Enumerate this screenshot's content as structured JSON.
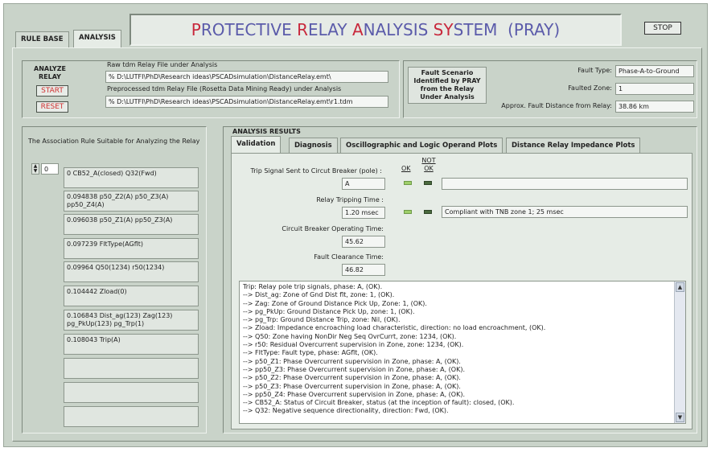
{
  "tabs": [
    "RULE BASE",
    "ANALYSIS"
  ],
  "title": {
    "parts": [
      {
        "t": "P",
        "red": true
      },
      {
        "t": "ROTECTIVE ",
        "red": false
      },
      {
        "t": "R",
        "red": true
      },
      {
        "t": "ELAY ",
        "red": false
      },
      {
        "t": "A",
        "red": true
      },
      {
        "t": "NALYSIS ",
        "red": false
      },
      {
        "t": "SY",
        "red": true
      },
      {
        "t": "STEM  (PRAY)",
        "red": false
      }
    ]
  },
  "stop_label": "STOP",
  "analyze": {
    "label": "ANALYZE RELAY",
    "start": "START",
    "reset": "RESET"
  },
  "files": {
    "raw_label": "Raw tdm Relay File under Analysis",
    "raw_path": "% D:\\LUTFI\\PhD\\Research ideas\\PSCADsimulation\\DistanceRelay.emt\\",
    "pre_label": "Preprocessed tdm Relay File  (Rosetta Data Mining Ready) under Analysis",
    "pre_path": "% D:\\LUTFI\\PhD\\Research ideas\\PSCADsimulation\\DistanceRelay.emt\\r1.tdm"
  },
  "fault": {
    "scenario_label": "Fault Scenario Identified by PRAY from the Relay Under Analysis",
    "type_label": "Fault Type:",
    "type_value": "Phase-A-to-Ground",
    "zone_label": "Faulted Zone:",
    "zone_value": "1",
    "dist_label": "Approx. Fault Distance from Relay:",
    "dist_value": "38.86 km"
  },
  "rules": {
    "heading": "The Association Rule Suitable for Analyzing the Relay",
    "index": "0",
    "items": [
      "0 CB52_A(closed) Q32(Fwd)",
      "0.094838 p50_Z2(A) p50_Z3(A) pp50_Z4(A)",
      "0.096038 p50_Z1(A) pp50_Z3(A)",
      "0.097239 FltType(AGflt)",
      "0.09964 Q50(1234) r50(1234)",
      "0.104442 Zload(0)",
      "0.106843 Dist_ag(123) Zag(123) pg_PkUp(123) pg_Trp(1)",
      "0.108043 Trip(A)",
      "",
      "",
      ""
    ]
  },
  "results": {
    "heading": "ANALYSIS RESULTS",
    "tabs": [
      "Validation",
      "Diagnosis",
      "Oscillographic and Logic Operand Plots",
      "Distance Relay Impedance Plots"
    ],
    "ok_label": "OK",
    "notok_label": "NOT OK",
    "trip_label": "Trip Signal Sent to Circut Breaker (pole) :",
    "trip_value": "A",
    "rtime_label": "Relay Tripping Time :",
    "rtime_value": "1.20 msec",
    "rtime_note": "Compliant with TNB zone 1; 25 msec",
    "cb_label": "Circuit Breaker Operating Time:",
    "cb_value": "45.62",
    "clear_label": "Fault Clearance Time:",
    "clear_value": "46.82",
    "log": [
      "Trip: Relay pole trip signals, phase: A, (OK).",
      "--> Dist_ag: Zone of Gnd Dist flt, zone: 1, (OK).",
      "--> Zag: Zone of Ground Distance Pick Up, Zone: 1, (OK).",
      "--> pg_PkUp: Ground Distance Pick Up, zone: 1, (OK).",
      "--> pg_Trp: Ground Distance Trip, zone: Nil, (OK).",
      "--> Zload: Impedance encroaching load characteristic, direction: no load encroachment, (OK).",
      "--> Q50: Zone having NonDir Neg Seq OvrCurrt, zone: 1234, (OK).",
      "--> r50: Residual Overcurrent supervision in Zone, zone: 1234, (OK).",
      "--> FltType: Fault type, phase: AGflt, (OK).",
      "--> p50_Z1: Phase Overcurrent supervision in Zone, phase: A, (OK).",
      "--> pp50_Z3: Phase Overcurrent supervision in Zone, phase: A, (OK).",
      "--> p50_Z2: Phase Overcurrent supervision in Zone, phase: A, (OK).",
      "--> p50_Z3: Phase Overcurrent supervision in Zone, phase: A, (OK).",
      "--> pp50_Z4: Phase Overcurrent supervision in Zone, phase: A, (OK).",
      "--> CB52_A: Status of Circuit Breaker, status (at the inception of fault): closed, (OK).",
      "--> Q32: Negative sequence directionality, direction: Fwd, (OK)."
    ]
  },
  "colors": {
    "panel": "#c9d3c9",
    "title_blue": "#5b5baa",
    "title_red": "#c8283c",
    "led_green": "#9fcf6a",
    "led_dark": "#4a6a3e"
  }
}
